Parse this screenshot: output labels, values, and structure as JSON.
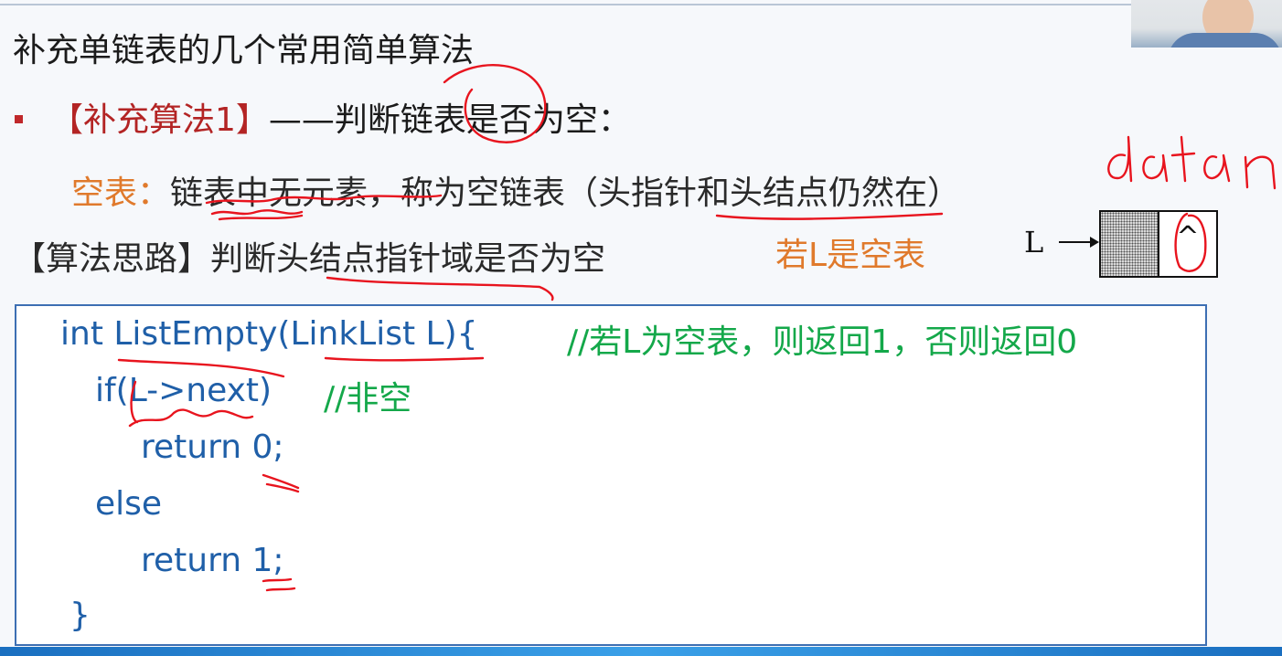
{
  "slide": {
    "title": "补充单链表的几个常用简单算法",
    "algorithm": {
      "bracket_label": "【补充算法1】",
      "dash": "——",
      "description": "判断链表是否为空："
    },
    "empty_table": {
      "label": "空表：",
      "text": "链表中无元素，称为空链表（头指针和头结点仍然在）"
    },
    "idea": {
      "text": "【算法思路】判断头结点指针域是否为空"
    },
    "note": "若L是空表",
    "diagram": {
      "pointer_label": "L",
      "null_symbol": "^"
    },
    "code": {
      "lines": [
        "int ListEmpty(LinkList L){",
        "if(L->next)",
        "return 0;",
        "else",
        "return 1;",
        "}"
      ],
      "comments": [
        "//若L为空表，则返回1，否则返回0",
        "//非空"
      ]
    },
    "handwriting": [
      "data",
      "n"
    ]
  },
  "colors": {
    "heading": "#1b1b1b",
    "red_label": "#b32424",
    "orange": "#e07a2c",
    "code_blue": "#1f5fa8",
    "comment_green": "#14a84a",
    "ink_red": "#e8141e",
    "box_border": "#3d6fb3"
  }
}
